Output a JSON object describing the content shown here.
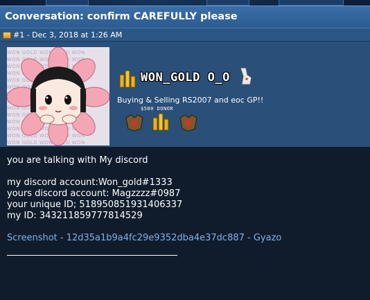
{
  "title_bar": {
    "title": "Conversation: confirm CAREFULLY please"
  },
  "post": {
    "header": "#1 - Dec 3, 2018 at 1:26 AM",
    "icon": "post-status-icon"
  },
  "signature": {
    "watermark_text": "WON GOLD WON GOLD WON",
    "logo_text": "WON_GOLD O_O",
    "tagline": "Buying & Selling RS2007 and eoc GP!!",
    "donor": "$500 DONOR",
    "colors": {
      "banner": "#2a4f78",
      "gold": "#e8b21a"
    }
  },
  "message": {
    "lines": [
      "you are talking with My discord",
      "my discord account:Won_gold#1333",
      "yours discord account: Magzzzz#0987",
      "your unique ID; 518950851931406337",
      "my ID: 343211859777814529"
    ],
    "link_text": "Screenshot - 12d35a1b9a4fc29e9352dba4e37dc887 - Gyazo"
  },
  "colors": {
    "title_bar": "#2c5b92",
    "body_bg": "#101c2c",
    "link": "#7fb3e8"
  }
}
